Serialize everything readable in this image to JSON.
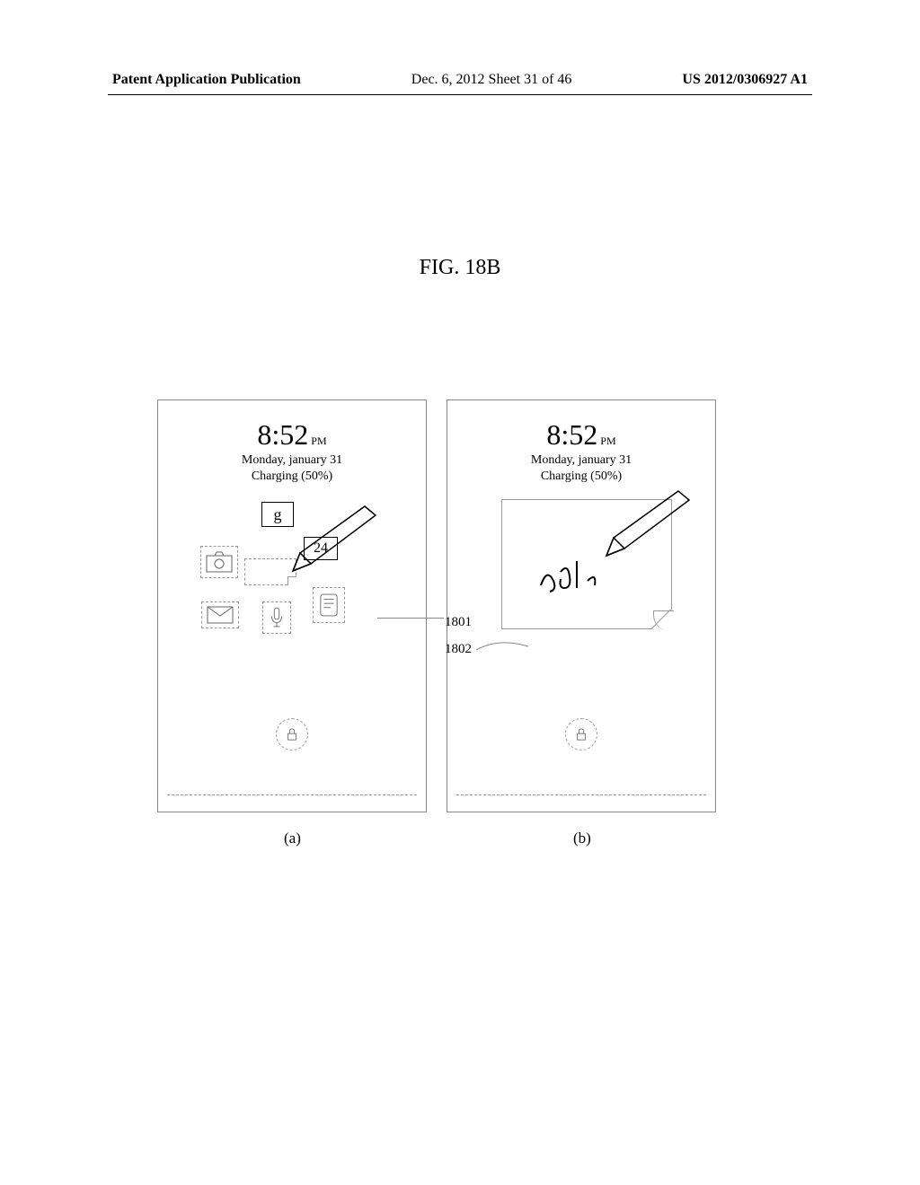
{
  "header": {
    "left": "Patent Application Publication",
    "center": "Dec. 6, 2012  Sheet 31 of 46",
    "right": "US 2012/0306927 A1"
  },
  "figure_label": "FIG.  18B",
  "panel_a": {
    "time": "8:52",
    "time_suffix": "PM",
    "date": "Monday, january 31",
    "charging": "Charging (50%)",
    "icon_g_label": "g",
    "icon_24_label": "24"
  },
  "panel_b": {
    "time": "8:52",
    "time_suffix": "PM",
    "date": "Monday, january 31",
    "charging": "Charging (50%)"
  },
  "refs": {
    "r1801": "1801",
    "r1802": "1802"
  },
  "labels": {
    "a": "(a)",
    "b": "(b)"
  }
}
